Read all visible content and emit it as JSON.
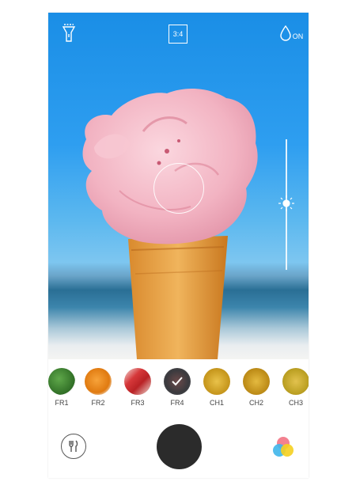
{
  "topbar": {
    "flash_icon": "flashlight-icon",
    "ratio_label": "3:4",
    "filter_toggle_icon": "water-drop-icon",
    "filter_toggle_label": "ON"
  },
  "viewfinder": {
    "subject": "ice-cream-cone-photo",
    "exposure_icon": "sun-icon"
  },
  "filters": [
    {
      "label": "FR1"
    },
    {
      "label": "FR2"
    },
    {
      "label": "FR3"
    },
    {
      "label": "FR4"
    },
    {
      "label": "CH1"
    },
    {
      "label": "CH2"
    },
    {
      "label": "CH3"
    }
  ],
  "bottom": {
    "left_icon": "fork-knife-icon",
    "shutter": "shutter-button",
    "right_icon": "color-circles-icon"
  },
  "colors": {
    "shutter": "#2b2b2b",
    "sky": "#1a8ee6"
  }
}
